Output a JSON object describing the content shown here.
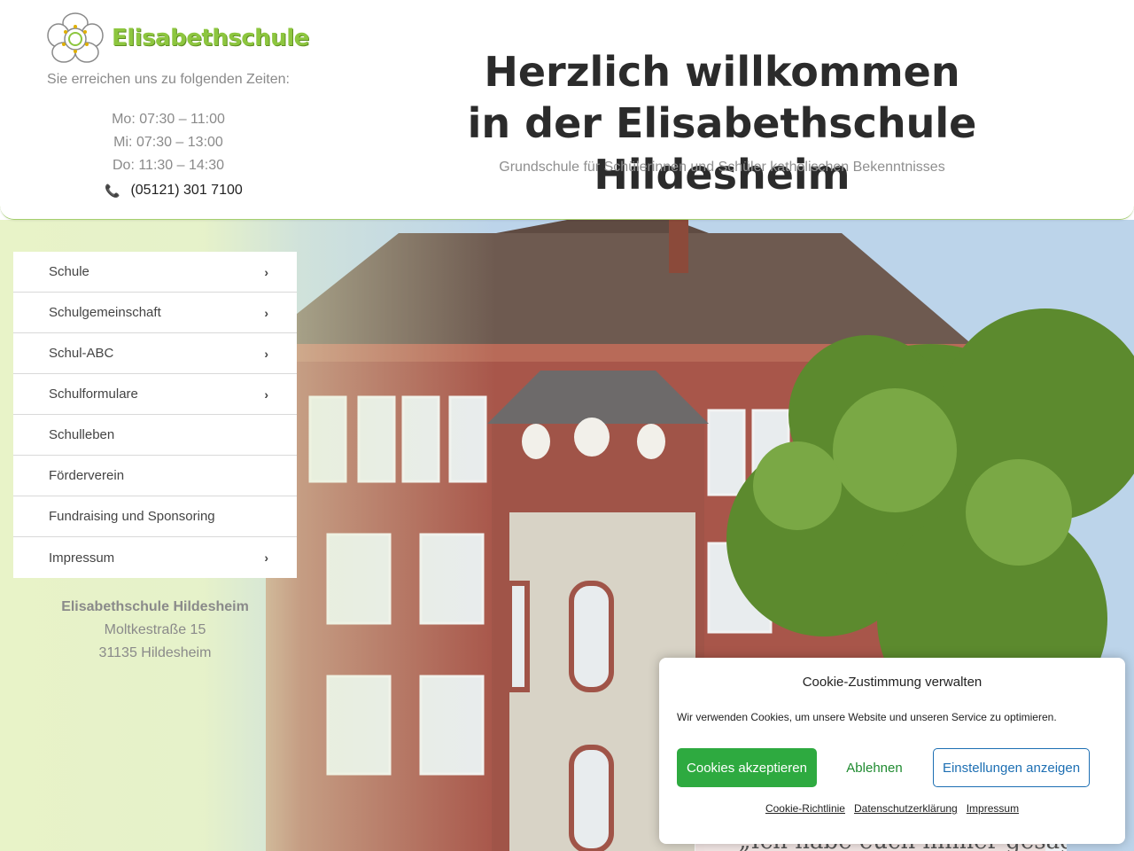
{
  "header": {
    "logo_text": "Elisabethschule",
    "hours_intro": "Sie erreichen uns zu folgenden Zeiten:",
    "hours": [
      "Mo: 07:30 – 11:00",
      "Mi:  07:30 – 13:00",
      "Do: 11:30 – 14:30"
    ],
    "phone": "(05121) 301 7100",
    "welcome_line1": "Herzlich willkommen",
    "welcome_line2": "in der Elisabethschule Hildesheim",
    "subtitle": "Grundschule für Schülerinnen und Schüler katholischen Bekenntnisses"
  },
  "menu": {
    "items": [
      {
        "label": "Schule",
        "has_submenu": true
      },
      {
        "label": "Schulgemeinschaft",
        "has_submenu": true
      },
      {
        "label": "Schul-ABC",
        "has_submenu": true
      },
      {
        "label": "Schulformulare",
        "has_submenu": true
      },
      {
        "label": "Schulleben",
        "has_submenu": false
      },
      {
        "label": "Förderverein",
        "has_submenu": false
      },
      {
        "label": "Fundraising und Sponsoring",
        "has_submenu": false
      },
      {
        "label": "Impressum",
        "has_submenu": true
      }
    ],
    "chevron_icon": "chevron-right-icon"
  },
  "address": {
    "name": "Elisabethschule Hildesheim",
    "street": "Moltkestraße 15",
    "city": "31135 Hildesheim"
  },
  "quote": "„Ich habe euch immer gesagt,",
  "cookie": {
    "title": "Cookie-Zustimmung verwalten",
    "text": "Wir verwenden Cookies, um unsere Website und unseren Service zu optimieren.",
    "accept_label": "Cookies akzeptieren",
    "deny_label": "Ablehnen",
    "settings_label": "Einstellungen anzeigen",
    "links": [
      "Cookie-Richtlinie",
      "Datenschutzerklärung",
      "Impressum"
    ]
  },
  "colors": {
    "brand_green": "#8dc63f",
    "accept_green": "#2eaa40",
    "settings_blue": "#1d6fb3"
  }
}
